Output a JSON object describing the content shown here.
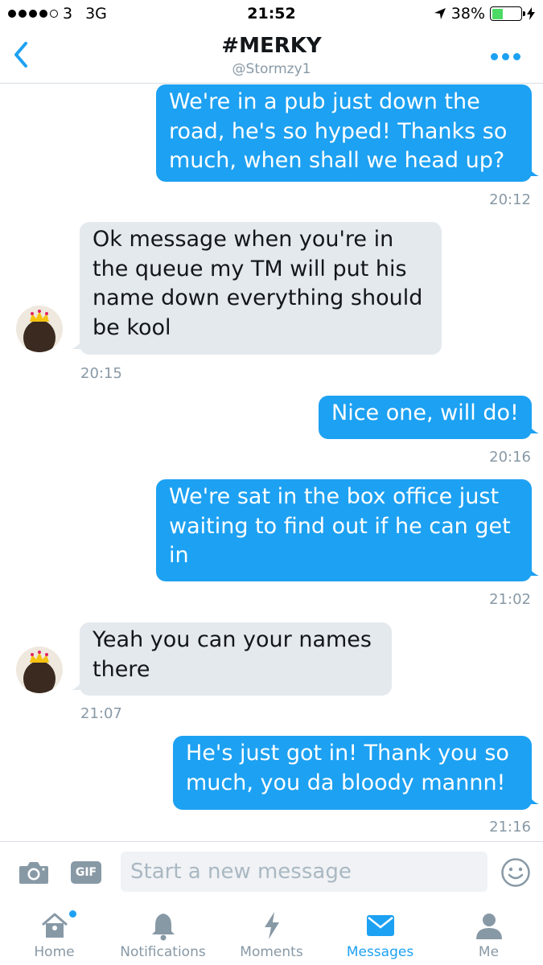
{
  "status_bar": {
    "carrier": "3",
    "network": "3G",
    "time": "21:52",
    "battery": "38%"
  },
  "header": {
    "title": "#MERKY",
    "handle": "@Stormzy1",
    "back_icon": "chevron-left-icon",
    "more_icon": "more-dots-icon"
  },
  "messages": [
    {
      "direction": "sent",
      "lines": [
        "We're in a pub just down the",
        "road, he's so hyped! Thanks so",
        "much, when shall we head up?"
      ],
      "time": "20:12"
    },
    {
      "direction": "received",
      "lines": [
        "Ok message when you're in",
        "the queue my TM will put his",
        "name down everything should",
        "be kool"
      ],
      "time": "20:15"
    },
    {
      "direction": "sent",
      "lines": [
        "Nice one, will do!"
      ],
      "time": "20:16"
    },
    {
      "direction": "sent",
      "lines": [
        "We're sat in the box office just",
        "waiting to find out if he can get",
        "in"
      ],
      "time": "21:02"
    },
    {
      "direction": "received",
      "lines": [
        "Yeah you can your names",
        "there"
      ],
      "time": "21:07"
    },
    {
      "direction": "sent",
      "lines": [
        "He's just got in! Thank you so",
        "much, you da bloody mannn!"
      ],
      "time": "21:16"
    }
  ],
  "composer": {
    "placeholder": "Start a new message",
    "gif_label": "GIF",
    "camera_icon": "camera-icon",
    "emoji_icon": "emoji-icon"
  },
  "tabs": [
    {
      "label": "Home",
      "icon": "home-icon",
      "active": false,
      "badge": true
    },
    {
      "label": "Notifications",
      "icon": "bell-icon",
      "active": false,
      "badge": false
    },
    {
      "label": "Moments",
      "icon": "lightning-icon",
      "active": false,
      "badge": false
    },
    {
      "label": "Messages",
      "icon": "envelope-icon",
      "active": true,
      "badge": false
    },
    {
      "label": "Me",
      "icon": "person-icon",
      "active": false,
      "badge": false
    }
  ],
  "colors": {
    "accent": "#1da1f2",
    "received_bubble": "#e4e9ee",
    "muted": "#8899a6"
  }
}
